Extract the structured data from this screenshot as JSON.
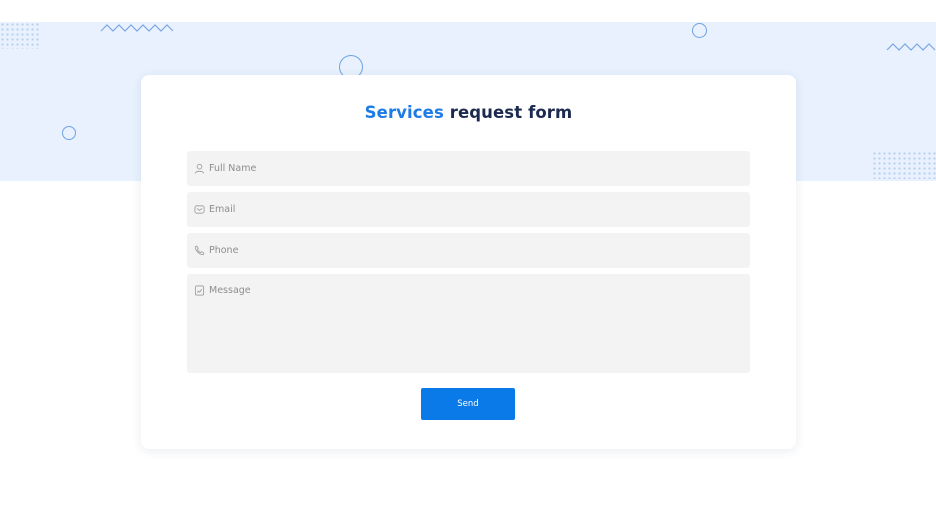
{
  "form": {
    "title_accent": "Services",
    "title_rest": " request form",
    "fields": {
      "full_name": {
        "placeholder": "Full Name",
        "icon": "user-icon"
      },
      "email": {
        "placeholder": "Email",
        "icon": "mail-icon"
      },
      "phone": {
        "placeholder": "Phone",
        "icon": "phone-icon"
      },
      "message": {
        "placeholder": "Message",
        "icon": "document-icon"
      }
    },
    "send_label": "Send"
  },
  "colors": {
    "accent": "#1c7be5",
    "button": "#0a7ae8",
    "hero_band": "#e8f1fd",
    "field_bg": "#f3f3f3",
    "title_dark": "#1b2a4e"
  }
}
